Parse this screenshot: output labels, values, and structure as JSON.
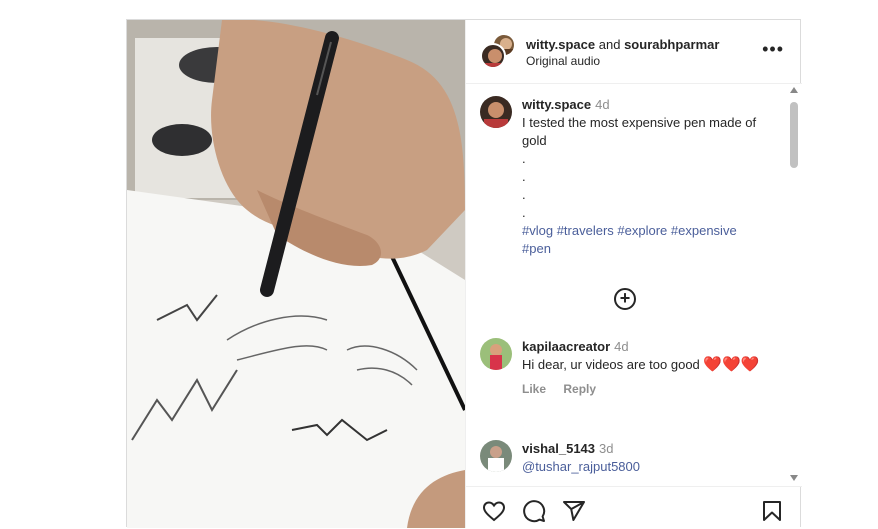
{
  "header": {
    "user1": "witty.space",
    "and_text": "and",
    "user2": "sourabhparmar",
    "subtitle": "Original audio",
    "more_icon": "more-horizontal-icon"
  },
  "caption": {
    "username": "witty.space",
    "time": "4d",
    "lines": [
      "I tested the most expensive pen made of gold",
      ".",
      ".",
      ".",
      "."
    ],
    "hashtags": [
      "#vlog",
      "#travelers",
      "#explore",
      "#expensive",
      "#pen"
    ]
  },
  "load_more_icon": "plus-circle-icon",
  "comments": [
    {
      "username": "kapilaacreator",
      "time": "4d",
      "text": "Hi dear, ur videos are too good",
      "emoji": "❤️❤️❤️",
      "like": "Like",
      "reply": "Reply"
    },
    {
      "username": "vishal_5143",
      "time": "3d",
      "text": "@tushar_rajput5800"
    }
  ],
  "actions": [
    "heart-icon",
    "comment-icon",
    "share-icon",
    "bookmark-icon"
  ],
  "colors": {
    "link": "#4a5e9a",
    "heart": "#e0245e",
    "muted": "#8e8e8e"
  }
}
